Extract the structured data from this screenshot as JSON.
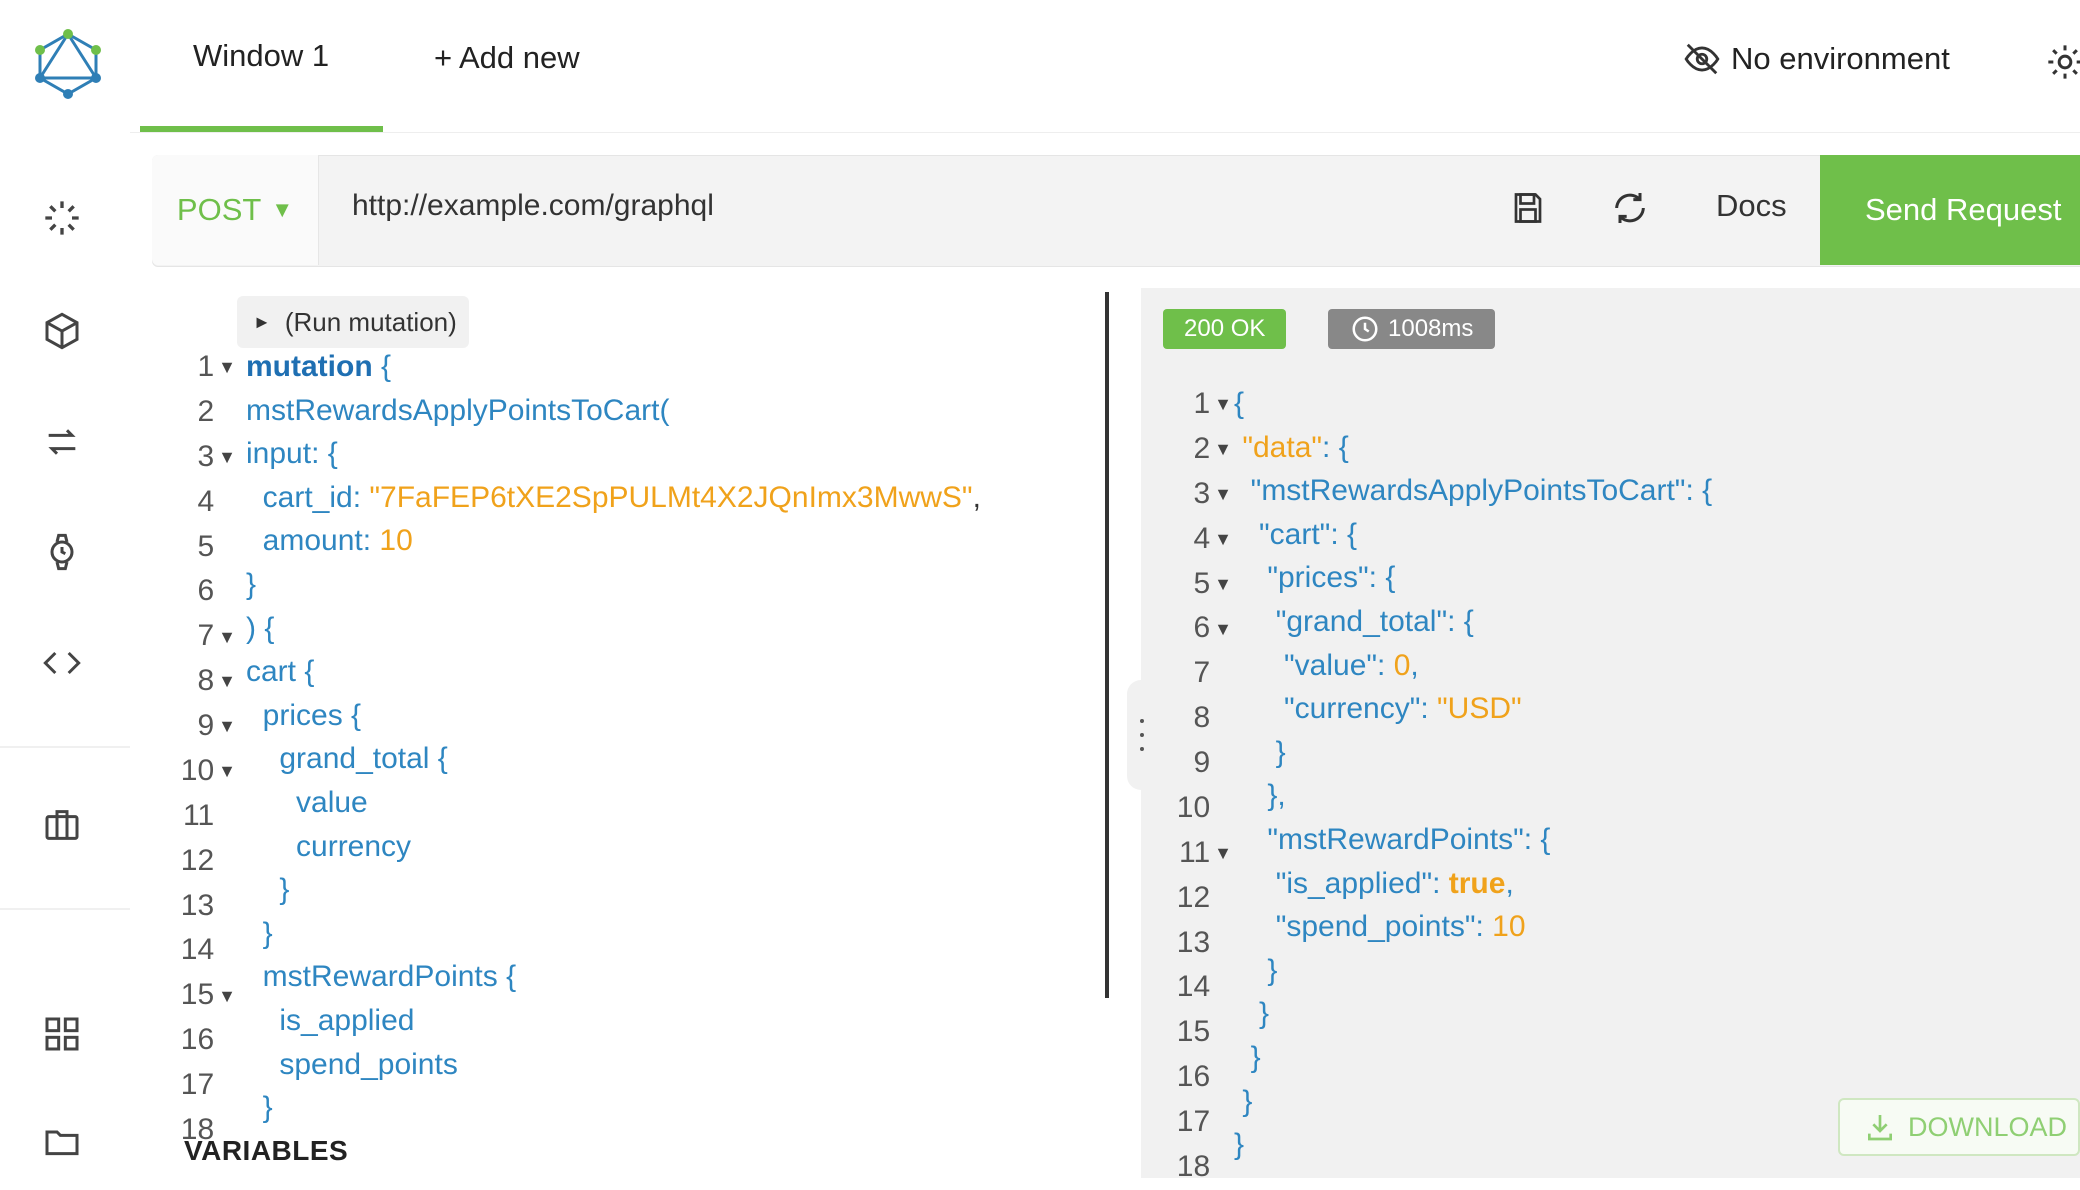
{
  "header": {
    "tabs": [
      {
        "label": "Window 1",
        "active": true
      }
    ],
    "add_new_label": "+ Add new",
    "environment_label": "No environment"
  },
  "sidebar": {
    "icons": [
      "loading-spinner-icon",
      "cube-icon",
      "sync-arrows-icon",
      "watch-icon",
      "code-icon",
      "briefcase-icon",
      "grid-icon",
      "folder-icon"
    ]
  },
  "request": {
    "method": "POST",
    "url": "http://example.com/graphql",
    "docs_label": "Docs",
    "send_label": "Send Request"
  },
  "editor": {
    "run_label": "(Run mutation)",
    "variables_label": "VARIABLES",
    "line_numbers": [
      "1",
      "2",
      "3",
      "4",
      "5",
      "6",
      "7",
      "8",
      "9",
      "10",
      "11",
      "12",
      "13",
      "14",
      "15",
      "16",
      "17",
      "18"
    ],
    "lines": {
      "l1": "mutation",
      "l2": "mstRewardsApplyPointsToCart(",
      "l3": "input",
      "l4_key": "cart_id",
      "l4_val": "\"7FaFEP6tXE2SpPULMt4X2JQnImx3MwwS\"",
      "l5_key": "amount",
      "l5_val": "10",
      "l8": "cart",
      "l9": "prices",
      "l10": "grand_total",
      "l11": "value",
      "l12": "currency",
      "l15": "mstRewardPoints",
      "l16": "is_applied",
      "l17": "spend_points"
    }
  },
  "response": {
    "status": "200 OK",
    "time": "1008ms",
    "download_label": "DOWNLOAD",
    "line_numbers": [
      "1",
      "2",
      "3",
      "4",
      "5",
      "6",
      "7",
      "8",
      "9",
      "10",
      "11",
      "12",
      "13",
      "14",
      "15",
      "16",
      "17",
      "18"
    ],
    "lines": {
      "k_data": "\"data\"",
      "k_apply": "\"mstRewardsApplyPointsToCart\"",
      "k_cart": "\"cart\"",
      "k_prices": "\"prices\"",
      "k_grand": "\"grand_total\"",
      "k_value": "\"value\"",
      "v_value": "0",
      "k_currency": "\"currency\"",
      "v_currency": "\"USD\"",
      "k_points": "\"mstRewardPoints\"",
      "k_applied": "\"is_applied\"",
      "v_applied": "true",
      "k_spend": "\"spend_points\"",
      "v_spend": "10"
    }
  },
  "colors": {
    "accent": "#6fbf4a",
    "code_blue": "#2e86c1",
    "code_orange": "#f0a21b"
  }
}
